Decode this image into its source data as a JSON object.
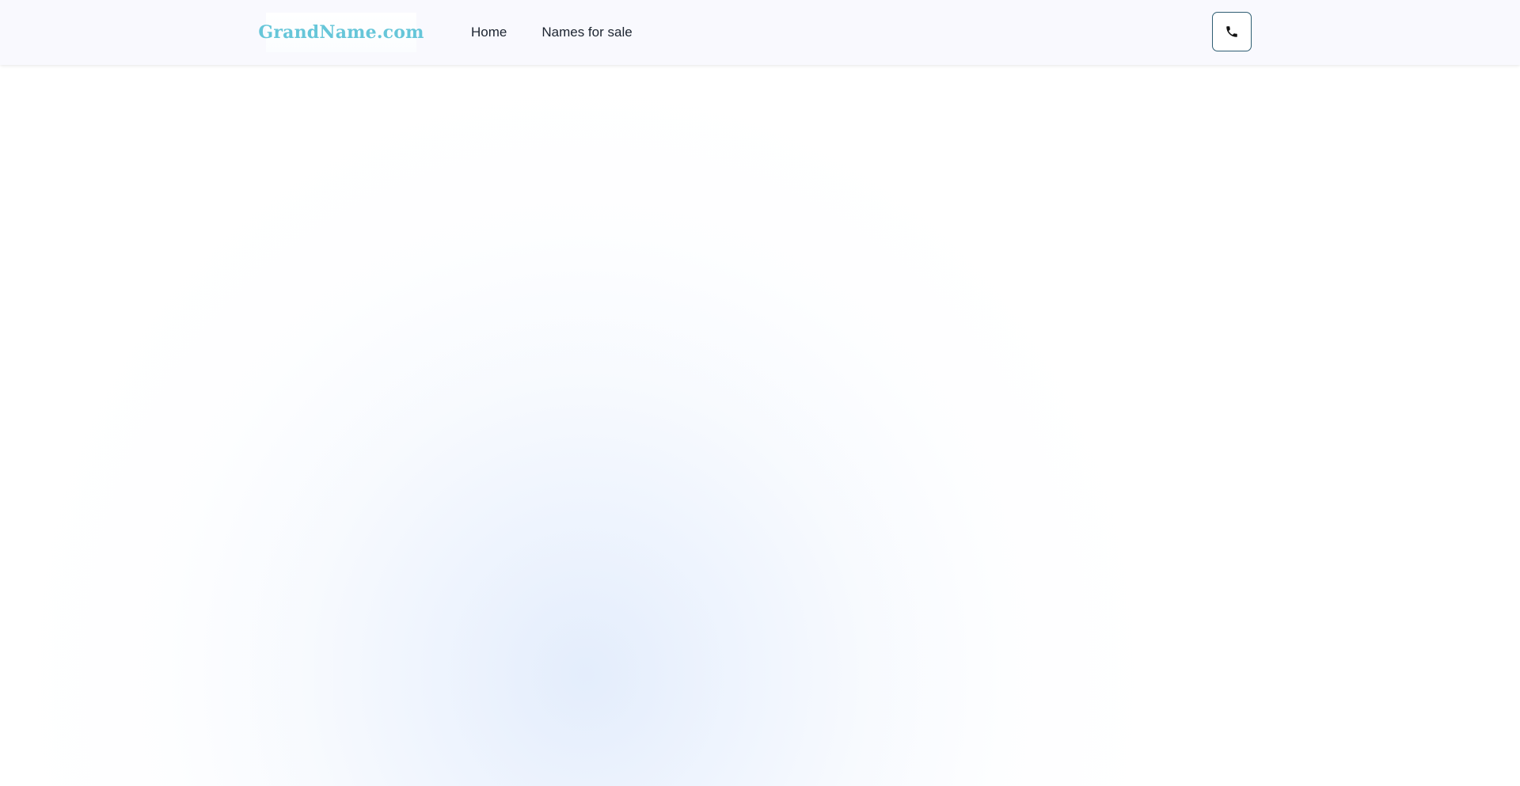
{
  "header": {
    "logo_text": "GrandName.com",
    "nav": [
      {
        "label": "Home"
      },
      {
        "label": "Names for sale"
      }
    ],
    "contact_button": {
      "icon": "phone-icon"
    }
  },
  "colors": {
    "logo": "#66c6d9",
    "nav_text": "#1c2430",
    "button_border": "#2f5e73",
    "header_bg": "#f9f9fe",
    "glow": "#e2ecfc"
  }
}
